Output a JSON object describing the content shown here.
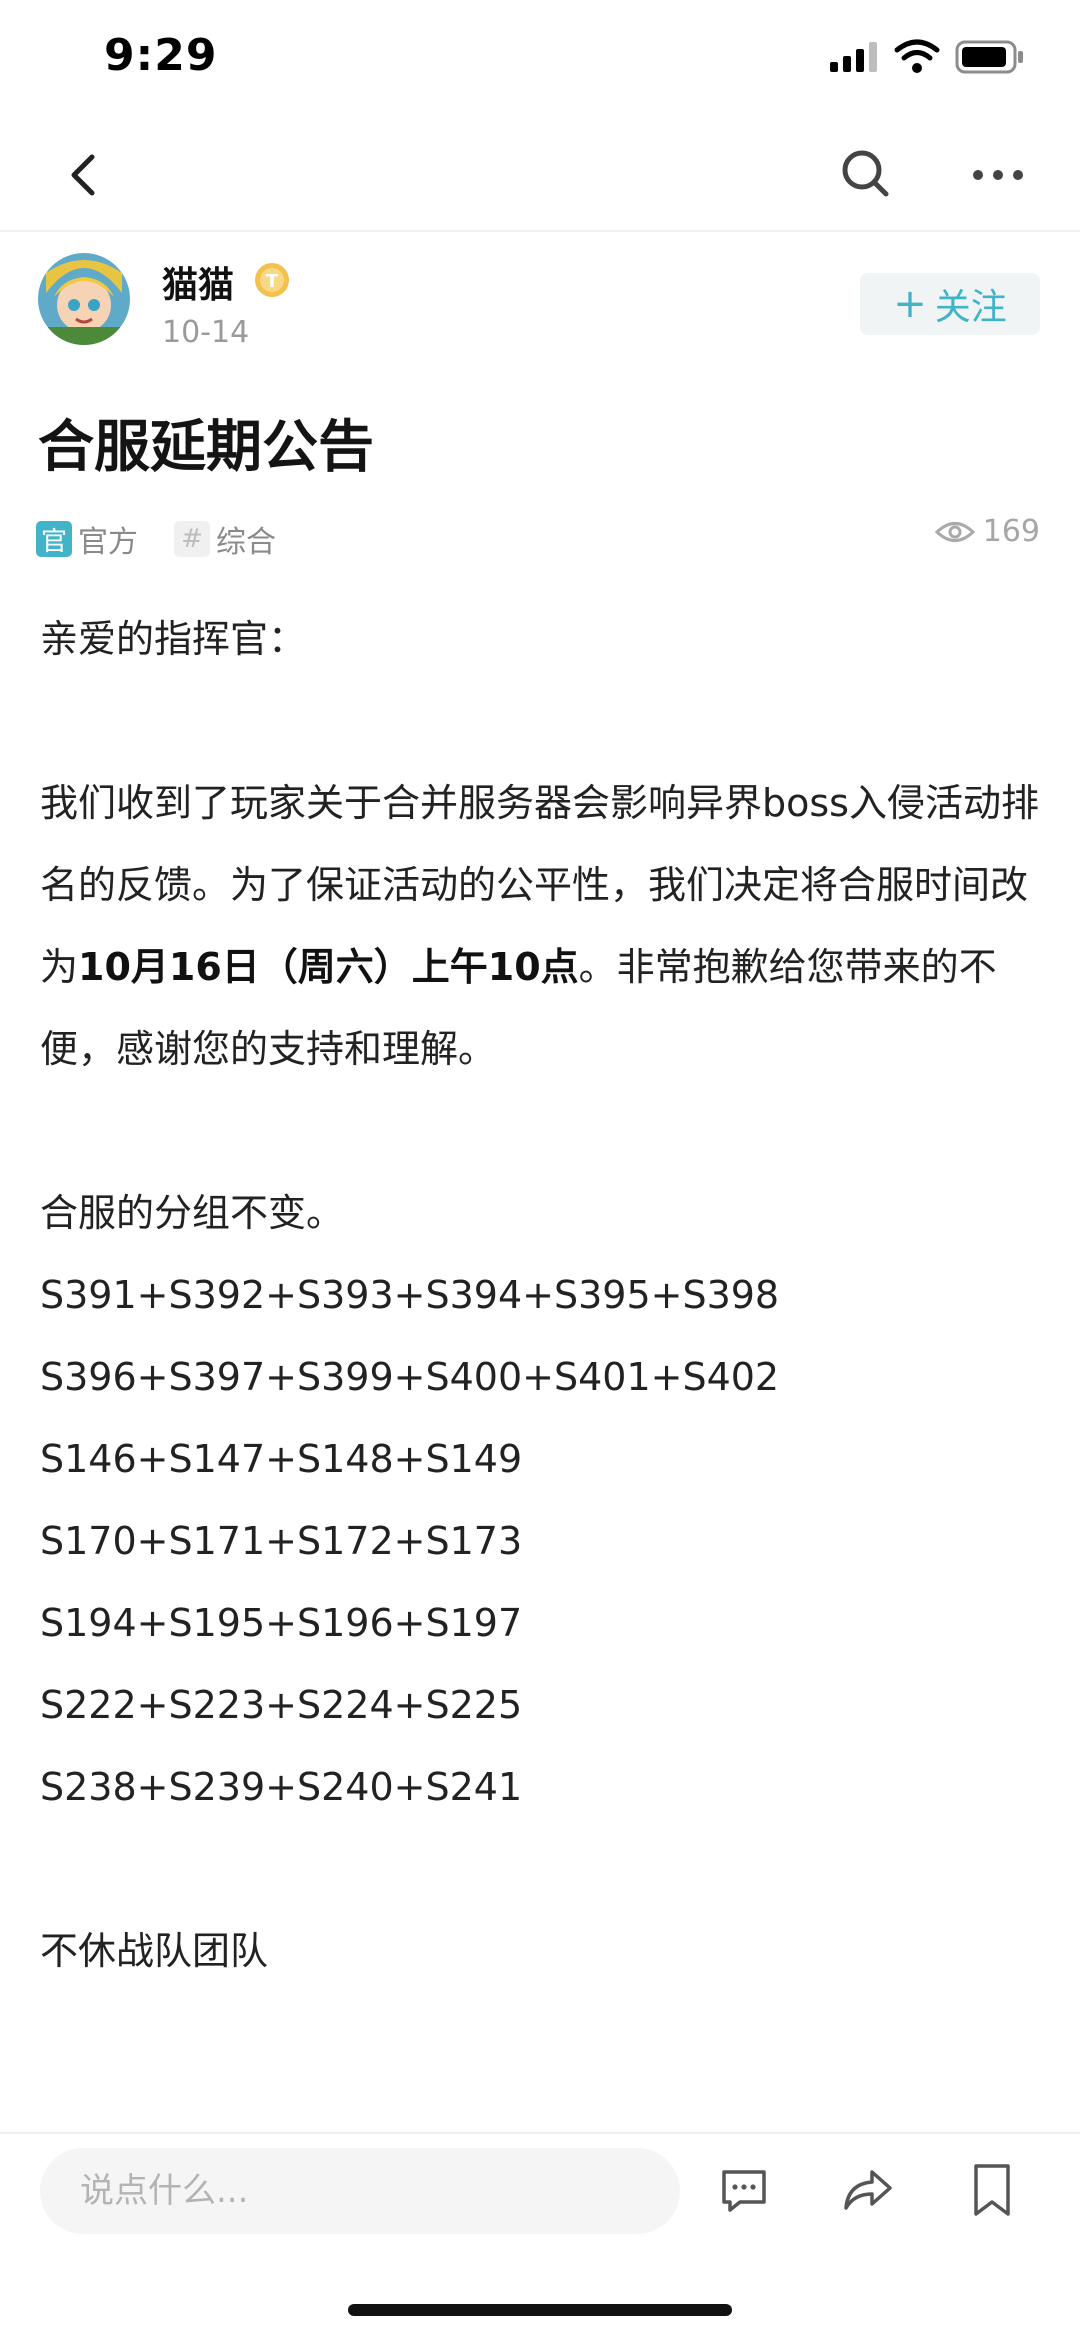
{
  "status_bar": {
    "time": "9:29"
  },
  "author": {
    "name": "猫猫",
    "date": "10-14",
    "follow_label": "关注"
  },
  "post": {
    "title": "合服延期公告",
    "tags": {
      "official_icon": "官",
      "official_label": "官方",
      "topic_icon": "#",
      "topic_label": "综合"
    },
    "view_count": "169",
    "body": {
      "greeting": "亲爱的指挥官：",
      "p1_before": "我们收到了玩家关于合并服务器会影响异界boss入侵活动排名的反馈。为了保证活动的公平性，我们决定将合服时间改为",
      "p1_bold": "10月16日（周六）上午10点",
      "p1_after": "。非常抱歉给您带来的不便，感谢您的支持和理解。",
      "groups_intro": "合服的分组不变。",
      "groups": [
        "S391+S392+S393+S394+S395+S398",
        "S396+S397+S399+S400+S401+S402",
        "S146+S147+S148+S149",
        "S170+S171+S172+S173",
        "S194+S195+S196+S197",
        "S222+S223+S224+S225",
        "S238+S239+S240+S241"
      ],
      "signature": "不休战队团队"
    }
  },
  "bottom_bar": {
    "comment_placeholder": "说点什么..."
  },
  "colors": {
    "accent": "#41b4c9",
    "badge_gold": "#f2c14e"
  }
}
